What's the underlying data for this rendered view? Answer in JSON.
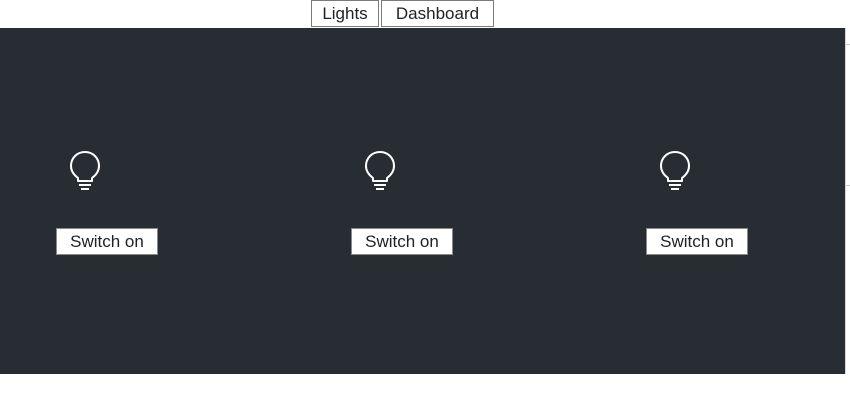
{
  "nav": {
    "tabs": [
      {
        "label": "Lights"
      },
      {
        "label": "Dashboard"
      }
    ]
  },
  "lights": [
    {
      "icon": "lightbulb-icon",
      "button_label": "Switch on"
    },
    {
      "icon": "lightbulb-icon",
      "button_label": "Switch on"
    },
    {
      "icon": "lightbulb-icon",
      "button_label": "Switch on"
    }
  ],
  "colors": {
    "panel_background": "#282c33",
    "page_background": "#ffffff",
    "icon_stroke": "#ffffff"
  }
}
